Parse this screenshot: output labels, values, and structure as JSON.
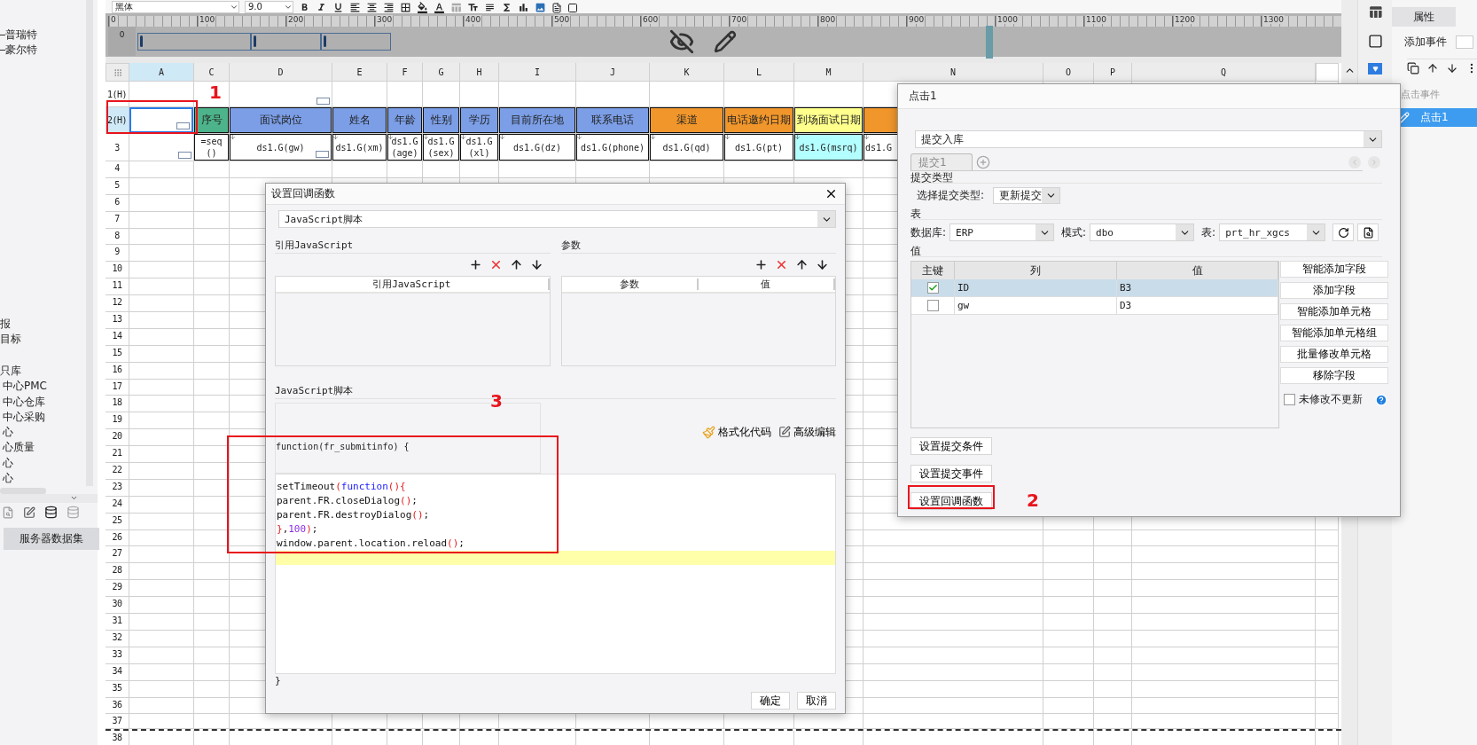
{
  "toolbar": {
    "font": "黑体",
    "size": "9.0"
  },
  "ruler": {
    "ticks": [
      "0",
      "100",
      "200",
      "300",
      "400",
      "500",
      "600",
      "700",
      "800",
      "900",
      "1000",
      "1100",
      "1200",
      "1300"
    ],
    "side_tick": "0"
  },
  "left_panel": {
    "tree_items": [
      {
        "label": "普瑞特",
        "kind": "branch"
      },
      {
        "label": "豪尔特",
        "kind": "branch"
      },
      {
        "label": "报",
        "kind": "node"
      },
      {
        "label": "目标",
        "kind": "node"
      },
      {
        "label": "只库",
        "kind": "node"
      },
      {
        "label": "中心PMC",
        "kind": "leaf"
      },
      {
        "label": "中心仓库",
        "kind": "leaf"
      },
      {
        "label": "中心采购",
        "kind": "leaf"
      },
      {
        "label": "心",
        "kind": "leaf"
      },
      {
        "label": "心质量",
        "kind": "leaf"
      },
      {
        "label": "心",
        "kind": "leaf"
      },
      {
        "label": "心",
        "kind": "leaf"
      }
    ],
    "tab": "服务器数据集"
  },
  "sheet": {
    "columns": [
      {
        "label": "A",
        "selected": true
      },
      {
        "label": "C",
        "selected": false
      },
      {
        "label": "D",
        "selected": false
      },
      {
        "label": "E",
        "selected": false
      },
      {
        "label": "F",
        "selected": false
      },
      {
        "label": "G",
        "selected": false
      },
      {
        "label": "H",
        "selected": false
      },
      {
        "label": "I",
        "selected": false
      },
      {
        "label": "J",
        "selected": false
      },
      {
        "label": "K",
        "selected": false
      },
      {
        "label": "L",
        "selected": false
      },
      {
        "label": "M",
        "selected": false
      },
      {
        "label": "N",
        "selected": false
      },
      {
        "label": "O",
        "selected": false
      },
      {
        "label": "P",
        "selected": false
      },
      {
        "label": "Q",
        "selected": false
      }
    ],
    "rows": [
      {
        "label": "1(H)",
        "selected": false,
        "cells": [
          {},
          {},
          {
            "widget": true
          }
        ]
      },
      {
        "label": "2(H)",
        "selected": true,
        "cells": [
          {
            "selected": true,
            "widget": true
          },
          {
            "text": "序号",
            "color": "#4db38a"
          },
          {
            "text": "面试岗位",
            "color": "#7b9ee6"
          },
          {
            "text": "姓名",
            "color": "#7b9ee6"
          },
          {
            "text": "年龄",
            "color": "#7b9ee6"
          },
          {
            "text": "性别",
            "color": "#7b9ee6"
          },
          {
            "text": "学历",
            "color": "#7b9ee6"
          },
          {
            "text": "目前所在地",
            "color": "#7b9ee6"
          },
          {
            "text": "联系电话",
            "color": "#7b9ee6"
          },
          {
            "text": "渠道",
            "color": "#f0962b"
          },
          {
            "text": "电话邀约日期",
            "color": "#f0962b"
          },
          {
            "text": "到场面试日期",
            "color": "#ffff8c"
          },
          {
            "color": "#f0962b"
          }
        ]
      },
      {
        "label": "3",
        "selected": false,
        "cells": [
          {
            "widget": true
          },
          {
            "text": "=seq()"
          },
          {
            "text": "ds1.G(gw)",
            "expand": true,
            "widget": true
          },
          {
            "text": "ds1.G(xm)",
            "expand": true
          },
          {
            "text": "ds1.G(age)",
            "expand": true
          },
          {
            "text": "ds1.G(sex)",
            "expand": true
          },
          {
            "text": "ds1.G(xl)",
            "expand": true
          },
          {
            "text": "ds1.G(dz)",
            "expand": true
          },
          {
            "text": "ds1.G(phone)",
            "expand": true
          },
          {
            "text": "ds1.G(qd)",
            "expand": true
          },
          {
            "text": "ds1.G(pt)",
            "expand": true
          },
          {
            "text": "ds1.G(msrq)",
            "expand": true,
            "color": "#b3ffff"
          },
          {
            "text": "ds1.G",
            "expand": true,
            "left_aligned": true
          }
        ]
      },
      {
        "label": "4",
        "selected": false
      },
      {
        "label": "5",
        "selected": false
      },
      {
        "label": "6",
        "selected": false
      },
      {
        "label": "7",
        "selected": false
      },
      {
        "label": "8",
        "selected": false
      },
      {
        "label": "9",
        "selected": false
      },
      {
        "label": "10",
        "selected": false
      },
      {
        "label": "11",
        "selected": false
      },
      {
        "label": "12",
        "selected": false
      },
      {
        "label": "13",
        "selected": false
      },
      {
        "label": "14",
        "selected": false
      },
      {
        "label": "15",
        "selected": false
      },
      {
        "label": "16",
        "selected": false
      },
      {
        "label": "17",
        "selected": false
      },
      {
        "label": "18",
        "selected": false
      },
      {
        "label": "19",
        "selected": false
      },
      {
        "label": "20",
        "selected": false
      },
      {
        "label": "21",
        "selected": false
      },
      {
        "label": "22",
        "selected": false
      },
      {
        "label": "23",
        "selected": false
      },
      {
        "label": "24",
        "selected": false
      },
      {
        "label": "25",
        "selected": false
      },
      {
        "label": "26",
        "selected": false
      },
      {
        "label": "27",
        "selected": false
      },
      {
        "label": "28",
        "selected": false
      },
      {
        "label": "29",
        "selected": false
      },
      {
        "label": "30",
        "selected": false
      },
      {
        "label": "31",
        "selected": false
      },
      {
        "label": "32",
        "selected": false
      },
      {
        "label": "33",
        "selected": false
      },
      {
        "label": "34",
        "selected": false
      },
      {
        "label": "35",
        "selected": false
      },
      {
        "label": "36",
        "selected": false
      },
      {
        "label": "37",
        "selected": false,
        "page_break": true
      },
      {
        "label": "38",
        "selected": false
      }
    ]
  },
  "callback_dialog": {
    "title": "设置回调函数",
    "type_select": "JavaScript脚本",
    "ref_group": {
      "label": "引用JavaScript",
      "columns": [
        "引用JavaScript"
      ]
    },
    "param_group": {
      "label": "参数",
      "columns": [
        "参数",
        "值"
      ]
    },
    "script": {
      "label": "JavaScript脚本",
      "header": "function(fr_submitinfo) {",
      "footer": "}",
      "actions": [
        "格式化代码",
        "高级编辑"
      ],
      "lines": [
        {
          "tokens": [
            {
              "text": "setTimeout",
              "kind": "plain"
            },
            {
              "text": "(",
              "kind": "paren"
            },
            {
              "text": "function",
              "kind": "keyword"
            },
            {
              "text": "(){",
              "kind": "paren"
            }
          ],
          "highlighted": false
        },
        {
          "tokens": [
            {
              "text": "parent.FR.closeDialog",
              "kind": "plain"
            },
            {
              "text": "()",
              "kind": "paren"
            },
            {
              "text": ";",
              "kind": "plain"
            }
          ],
          "highlighted": false
        },
        {
          "tokens": [
            {
              "text": "parent.FR.destroyDialog",
              "kind": "plain"
            },
            {
              "text": "()",
              "kind": "paren"
            },
            {
              "text": ";",
              "kind": "plain"
            }
          ],
          "highlighted": false
        },
        {
          "tokens": [
            {
              "text": "}",
              "kind": "paren"
            },
            {
              "text": ",",
              "kind": "plain"
            },
            {
              "text": "100",
              "kind": "number"
            },
            {
              "text": ")",
              "kind": "paren"
            },
            {
              "text": ";",
              "kind": "plain"
            }
          ],
          "highlighted": false
        },
        {
          "tokens": [
            {
              "text": "window.parent.location.reload",
              "kind": "plain"
            },
            {
              "text": "()",
              "kind": "paren"
            },
            {
              "text": ";",
              "kind": "plain"
            }
          ],
          "highlighted": false
        },
        {
          "highlighted": true
        }
      ]
    },
    "buttons": [
      "确定",
      "取消"
    ]
  },
  "event_dialog": {
    "title": "点击1",
    "action_select": "提交入库",
    "tabs": [
      {
        "label": "提交1",
        "selected": true
      }
    ],
    "submit_type": {
      "label": "提交类型",
      "field_label": "选择提交类型:",
      "value": "更新提交"
    },
    "table_group": {
      "label": "表",
      "fields": [
        {
          "label": "数据库:",
          "value": "ERP"
        },
        {
          "label": "模式:",
          "value": "dbo"
        },
        {
          "label": "表:",
          "value": "prt_hr_xgcs"
        }
      ]
    },
    "value_group": {
      "label": "值",
      "columns": [
        "主键",
        "列",
        "值"
      ],
      "rows": [
        {
          "checked": true,
          "selected": true,
          "column": "ID",
          "value": "B3"
        },
        {
          "checked": false,
          "selected": false,
          "column": "gw",
          "value": "D3"
        }
      ],
      "side_buttons": [
        "智能添加字段",
        "添加字段",
        "智能添加单元格",
        "智能添加单元格组",
        "批量修改单元格",
        "移除字段"
      ],
      "option": {
        "label": "未修改不更新",
        "checked": false
      }
    },
    "bottom_buttons": [
      "设置提交条件",
      "设置提交事件",
      "设置回调函数"
    ]
  },
  "properties": {
    "tab": "属性",
    "add_event_label": "添加事件",
    "list_header": "点击事件",
    "events": [
      {
        "label": "点击1",
        "selected": true
      }
    ]
  },
  "annotations": [
    {
      "label": "1"
    },
    {
      "label": "2"
    },
    {
      "label": "3"
    }
  ]
}
